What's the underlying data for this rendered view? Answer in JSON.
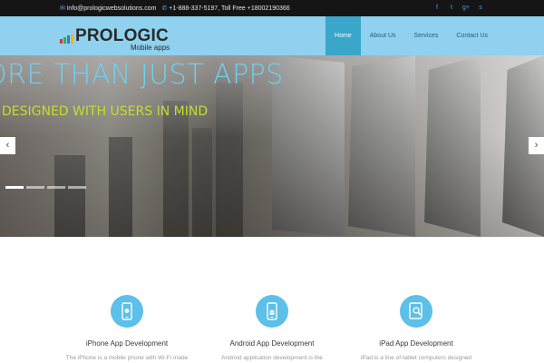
{
  "topbar": {
    "email": "info@prologicwebsolutions.com",
    "phone": "+1-888-337-5197, Toll Free +18002190366",
    "social": [
      {
        "icon": "facebook-icon",
        "glyph": "f"
      },
      {
        "icon": "twitter-icon",
        "glyph": "t"
      },
      {
        "icon": "google-plus-icon",
        "glyph": "g+"
      },
      {
        "icon": "skype-icon",
        "glyph": "s"
      }
    ]
  },
  "logo": {
    "word": "PROLOGIC",
    "sub": "Mobile apps",
    "bar_colors": [
      "#e0342b",
      "#2db24a",
      "#2a7ed8",
      "#f2b21b"
    ]
  },
  "nav": {
    "items": [
      "Home",
      "About Us",
      "Services",
      "Contact Us"
    ],
    "active": "Home"
  },
  "hero": {
    "headline": "ORE THAN JUST APPS",
    "subline": "DESIGNED WITH USERS IN MIND",
    "prev_glyph": "‹",
    "next_glyph": "›",
    "slide_count": 4,
    "active_slide": 1,
    "headline_color": "#6fd0f0",
    "subline_color": "#c7dd2c"
  },
  "services": [
    {
      "title": "iPhone App Development",
      "desc": "The iPhone is a mobile phone with Wi-Fi made",
      "icon": "iphone-apple-icon"
    },
    {
      "title": "Android App Development",
      "desc": "Android application development is the",
      "icon": "android-phone-icon"
    },
    {
      "title": "iPad App Development",
      "desc": "iPad is a line of tablet computers designed",
      "icon": "ipad-search-icon"
    }
  ],
  "colors": {
    "topbar_bg": "#151515",
    "header_bg": "#8fd1ee",
    "nav_active_bg": "#3aa6c9",
    "accent": "#5cc0e8"
  }
}
